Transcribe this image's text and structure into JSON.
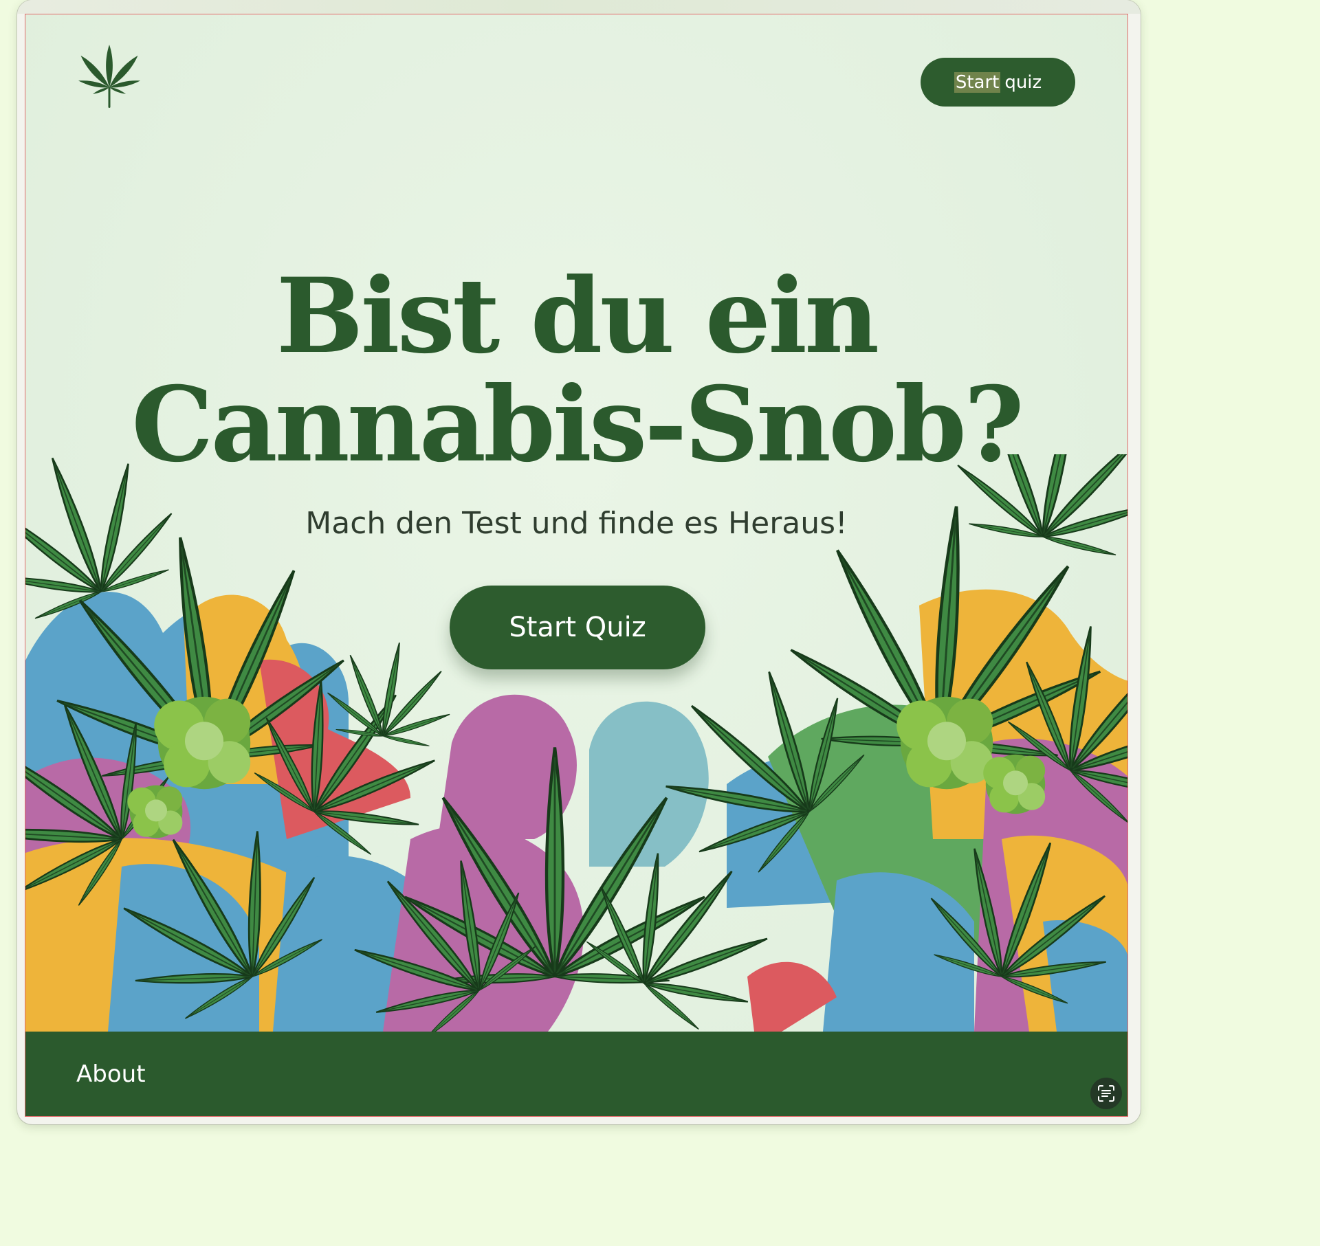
{
  "header": {
    "logo_icon": "cannabis-leaf-icon",
    "nav_button": {
      "highlighted": "Start",
      "rest": "quiz"
    }
  },
  "hero": {
    "title_line1": "Bist du ein",
    "title_line2": "Cannabis-Snob?",
    "subtitle": "Mach den Test und finde es Heraus!",
    "cta_label": "Start Quiz"
  },
  "footer": {
    "about_label": "About"
  },
  "overlay": {
    "scan_icon": "text-scan-icon"
  },
  "colors": {
    "primary_green": "#2b5a2d",
    "page_background": "#e3f1e0",
    "outer_background": "#f0fbe0",
    "blob_blue": "#5ba3c9",
    "blob_yellow": "#eeb43a",
    "blob_pink": "#b86aa6",
    "blob_red": "#dc5a5f",
    "blob_teal": "#86bfc6",
    "leaf_green": "#3f8a43"
  }
}
